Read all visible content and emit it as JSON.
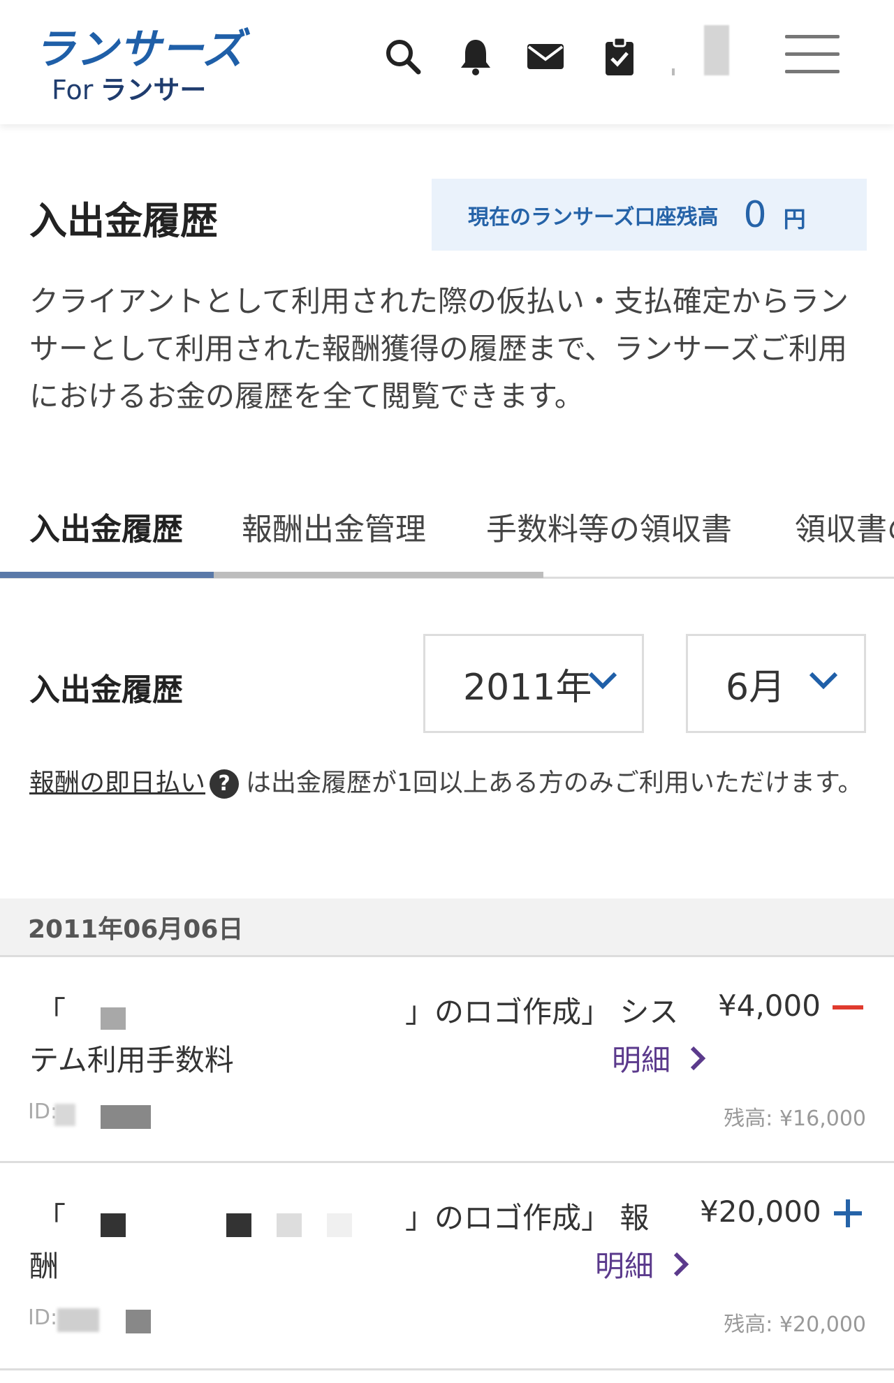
{
  "header": {
    "logo_main": "ランサーズ",
    "logo_for": "For",
    "logo_sub": "ランサー"
  },
  "page": {
    "title": "入出金履歴",
    "balance_label": "現在のランサーズ口座残高",
    "balance_value": "0",
    "balance_unit": "円",
    "description": "クライアントとして利用された際の仮払い・支払確定からランサーとして利用された報酬獲得の履歴まで、ランサーズご利用におけるお金の履歴を全て閲覧できます。"
  },
  "tabs": [
    {
      "label": "入出金履歴"
    },
    {
      "label": "報酬出金管理"
    },
    {
      "label": "手数料等の領収書"
    },
    {
      "label": "領収書の"
    }
  ],
  "filter": {
    "section_title": "入出金履歴",
    "year": "2011年",
    "month": "6月"
  },
  "note": {
    "link": "報酬の即日払い",
    "help": "?",
    "text": "は出金履歴が1回以上ある方のみご利用いただけます。"
  },
  "date_header": "2011年06月06日",
  "entries": [
    {
      "quote_open": "「",
      "quote_close": "」のロゴ作成」 シス",
      "line2": "テム利用手数料",
      "amount": "¥4,000",
      "detail": "明細",
      "id_label": "ID:",
      "balance": "残高: ¥16,000",
      "type": "minus",
      "sign_color": "#e03b2e"
    },
    {
      "quote_open": "「",
      "quote_close": "」のロゴ作成」 報",
      "line2": "酬",
      "amount": "¥20,000",
      "detail": "明細",
      "id_label": "ID:",
      "balance": "残高: ¥20,000",
      "type": "plus",
      "sign_color": "#2563a8"
    }
  ]
}
